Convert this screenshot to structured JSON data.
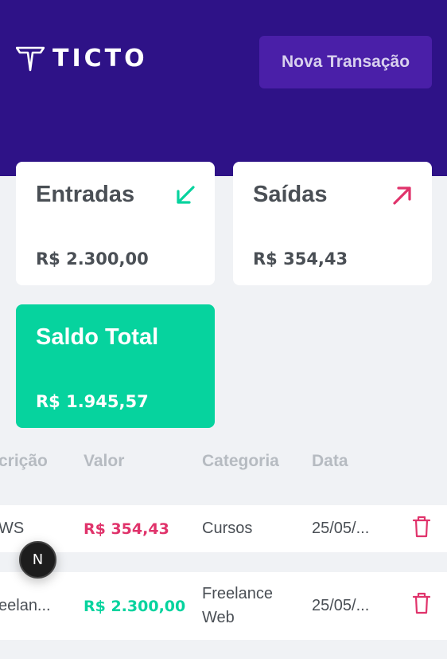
{
  "brand": {
    "logo_text": "TICTO"
  },
  "header": {
    "new_transaction_label": "Nova Transação"
  },
  "summary": {
    "income": {
      "title": "Entradas",
      "amount": "R$ 2.300,00",
      "icon": "arrow-down-left-icon",
      "color": "#06d39e"
    },
    "outcome": {
      "title": "Saídas",
      "amount": "R$ 354,43",
      "icon": "arrow-up-right-icon",
      "color": "#e0336b"
    },
    "total": {
      "title": "Saldo Total",
      "amount": "R$ 1.945,57",
      "color": "#06d39e"
    }
  },
  "table": {
    "columns": [
      "crição",
      "Valor",
      "Categoria",
      "Data"
    ],
    "rows": [
      {
        "description": "WS",
        "value": "R$ 354,43",
        "type": "outcome",
        "category": "Cursos",
        "date": "25/05/..."
      },
      {
        "description": "eelan...",
        "value": "R$ 2.300,00",
        "type": "income",
        "category": "Freelance Web",
        "date": "25/05/..."
      }
    ]
  },
  "fab": {
    "label": "N"
  },
  "colors": {
    "header_bg": "#2e1287",
    "button_bg": "#4a1fa8",
    "page_bg": "#f0f2f5"
  }
}
